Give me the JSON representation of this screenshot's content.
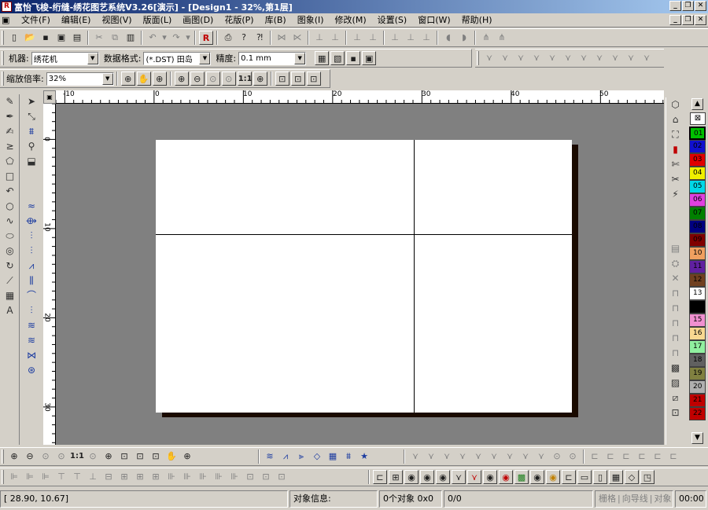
{
  "window": {
    "title": "富怡飞梭-绗缝-绣花图艺系统V3.26[演示] - [Design1 - 32%,第1层]",
    "app_icon_label": "R",
    "controls": [
      "_",
      "❐",
      "✕"
    ],
    "mdi_controls": [
      "_",
      "❐",
      "✕"
    ]
  },
  "menu": [
    {
      "label": "文件(F)"
    },
    {
      "label": "编辑(E)"
    },
    {
      "label": "视图(V)"
    },
    {
      "label": "版面(L)"
    },
    {
      "label": "画图(D)"
    },
    {
      "label": "花版(P)"
    },
    {
      "label": "库(B)"
    },
    {
      "label": "图象(I)"
    },
    {
      "label": "修改(M)"
    },
    {
      "label": "设置(S)"
    },
    {
      "label": "窗口(W)"
    },
    {
      "label": "帮助(H)"
    }
  ],
  "toolbar_machine": {
    "machine_label": "机器:",
    "machine_value": "绣花机",
    "format_label": "数据格式:",
    "format_value": "(*.DST) 田岛",
    "precision_label": "精度:",
    "precision_value": "0.1 mm"
  },
  "toolbar_zoom": {
    "zoom_label": "缩放倍率:",
    "zoom_value": "32%",
    "one_to_one": "1:1"
  },
  "rulers": {
    "h_ticks": [
      "-10",
      "0",
      "10",
      "20",
      "30",
      "40",
      "50"
    ],
    "v_ticks": [
      "0",
      "10",
      "20",
      "30"
    ]
  },
  "palette": [
    {
      "label": "01",
      "color": "#00c000",
      "selected": true
    },
    {
      "label": "02",
      "color": "#1010d0"
    },
    {
      "label": "03",
      "color": "#e00000"
    },
    {
      "label": "04",
      "color": "#f0f000"
    },
    {
      "label": "05",
      "color": "#00d8e8"
    },
    {
      "label": "06",
      "color": "#e040e0"
    },
    {
      "label": "07",
      "color": "#008000"
    },
    {
      "label": "08",
      "color": "#000080"
    },
    {
      "label": "09",
      "color": "#800000"
    },
    {
      "label": "10",
      "color": "#f0a060"
    },
    {
      "label": "11",
      "color": "#6020a0"
    },
    {
      "label": "12",
      "color": "#704020"
    },
    {
      "label": "13",
      "color": "#ffffff"
    },
    {
      "label": "14",
      "color": "#000000"
    },
    {
      "label": "15",
      "color": "#f090d0"
    },
    {
      "label": "16",
      "color": "#f8d890"
    },
    {
      "label": "17",
      "color": "#90f0a0"
    },
    {
      "label": "18",
      "color": "#606060"
    },
    {
      "label": "19",
      "color": "#808040"
    },
    {
      "label": "20",
      "color": "#b0b0b0"
    },
    {
      "label": "21",
      "color": "#c00000"
    },
    {
      "label": "22",
      "color": "#c00000"
    }
  ],
  "status": {
    "coords": "[      28.90,       10.67]",
    "object_info_label": "对象信息:",
    "object_count": "0个对象 0x0",
    "ratio": "0/0",
    "grid_label": "栅格",
    "guide_label": "向导线",
    "object_label": "对象",
    "time": "00:00"
  }
}
